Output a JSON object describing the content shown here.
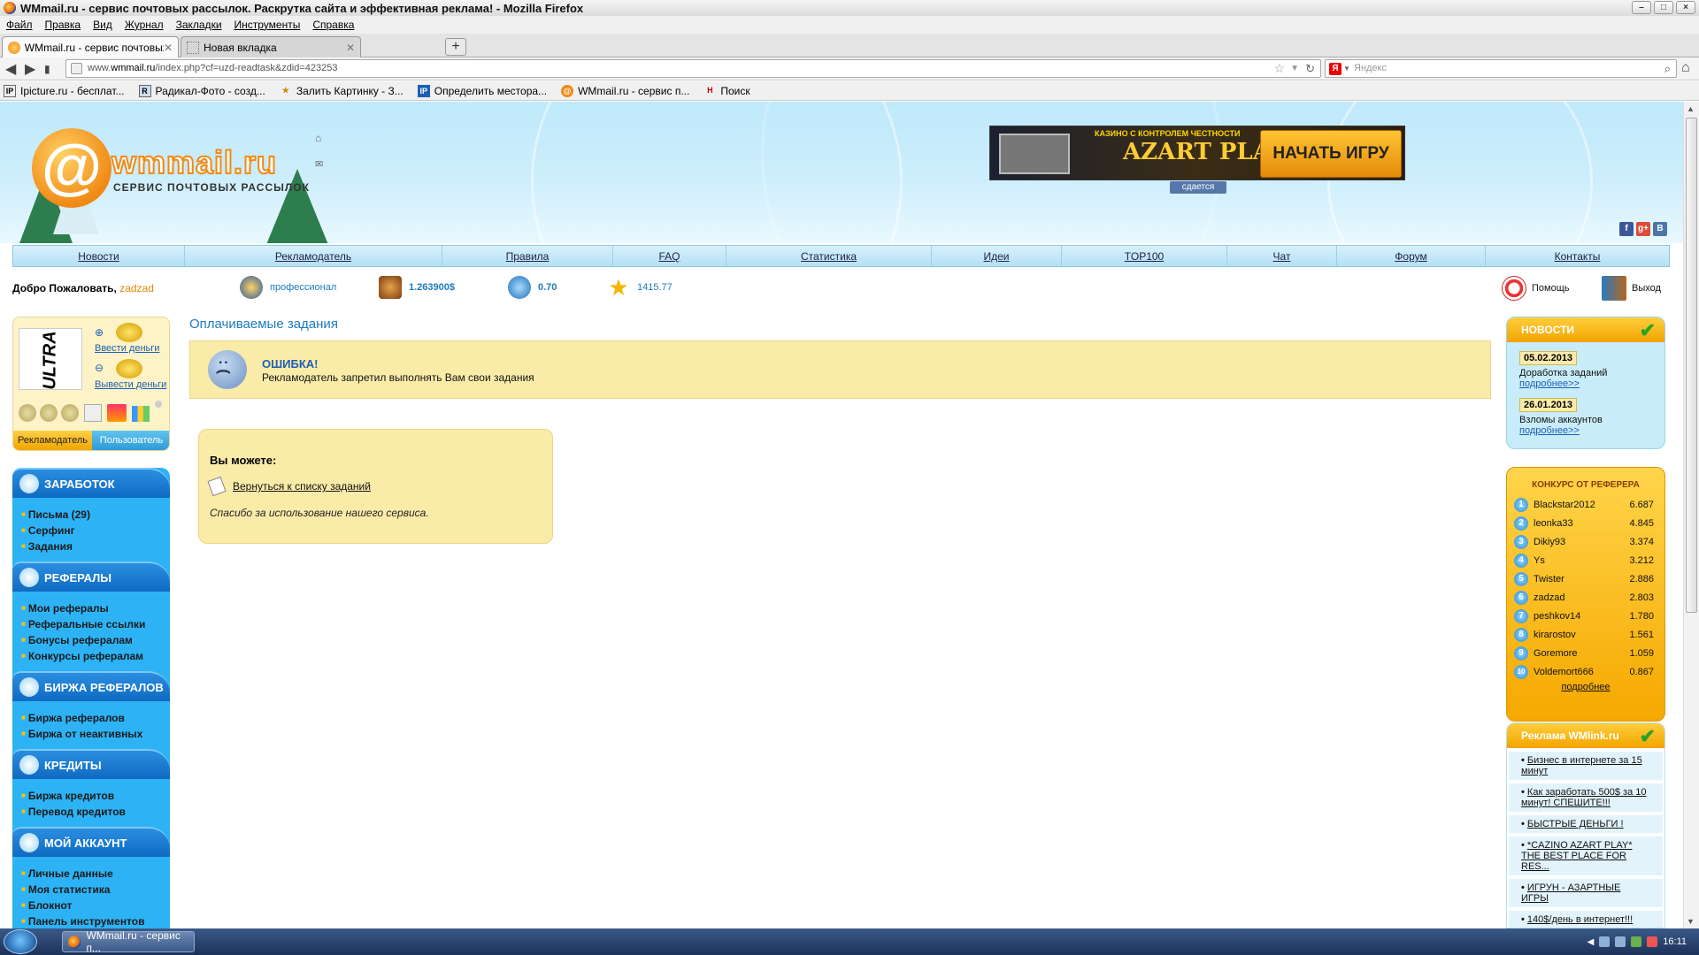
{
  "window": {
    "title": "WMmail.ru - сервис почтовых рассылок. Раскрутка сайта и эффективная реклама! - Mozilla Firefox"
  },
  "menubar": [
    "Файл",
    "Правка",
    "Вид",
    "Журнал",
    "Закладки",
    "Инструменты",
    "Справка"
  ],
  "tabs": [
    {
      "label": "WMmail.ru - сервис почтовых рассылок...",
      "active": true
    },
    {
      "label": "Новая вкладка",
      "active": false
    }
  ],
  "address": {
    "prefix": "www.",
    "domain": "wmmail.ru",
    "path": "/index.php?cf=uzd-readtask&zdid=423253"
  },
  "search": {
    "placeholder": "Яндекс",
    "engine_glyph": "Я"
  },
  "bookmarks": [
    {
      "label": "Ipicture.ru - бесплат...",
      "glyph": "IP"
    },
    {
      "label": "Радикал-Фото - созд...",
      "glyph": "R"
    },
    {
      "label": "Залить Картинку - З...",
      "glyph": "★"
    },
    {
      "label": "Определить местора...",
      "glyph": "IP"
    },
    {
      "label": "WMmail.ru - сервис п...",
      "glyph": "@"
    },
    {
      "label": "Поиск",
      "glyph": "H"
    }
  ],
  "header": {
    "logo_at": "@",
    "logo_name": "wmmail.ru",
    "logo_sub": "СЕРВИС ПОЧТОВЫХ РАССЫЛОК",
    "banner_slogan": "КАЗИНО С КОНТРОЛЕМ ЧЕСТНОСТИ",
    "banner_brand": "AZART PLAY",
    "banner_cta": "НАЧАТЬ ИГРУ",
    "banner_rent": "сдается",
    "social": [
      {
        "glyph": "f",
        "color": "#3b5998"
      },
      {
        "glyph": "g+",
        "color": "#dd4b39"
      },
      {
        "glyph": "B",
        "color": "#4a76a8"
      }
    ]
  },
  "topmenu": [
    "Новости",
    "Рекламодатель",
    "Правила",
    "FAQ",
    "Статистика",
    "Идеи",
    "TOP100",
    "Чат",
    "Форум",
    "Контакты"
  ],
  "welcome": {
    "label": "Добро Пожаловать,",
    "username": "zadzad",
    "status": "профессионал",
    "balance": "1.263900$",
    "credits": "0.70",
    "rating": "1415.77",
    "help": "Помощь",
    "logout": "Выход"
  },
  "userbox": {
    "avatar_text": "ULTRA",
    "deposit": "Ввести деньги",
    "withdraw": "Вывести деньги",
    "role_advertiser": "Рекламодатель",
    "role_user": "Пользователь"
  },
  "leftnav": [
    {
      "title": "ЗАРАБОТОК",
      "items": [
        "Письма (29)",
        "Серфинг",
        "Задания"
      ]
    },
    {
      "title": "РЕФЕРАЛЫ",
      "items": [
        "Мои рефералы",
        "Реферальные ссылки",
        "Бонусы рефералам",
        "Конкурсы рефералам"
      ]
    },
    {
      "title": "БИРЖА РЕФЕРАЛОВ",
      "items": [
        "Биржа рефералов",
        "Биржа от неактивных"
      ]
    },
    {
      "title": "КРЕДИТЫ",
      "items": [
        "Биржа кредитов",
        "Перевод кредитов"
      ]
    },
    {
      "title": "МОЙ АККАУНТ",
      "items": [
        "Личные данные",
        "Моя статистика",
        "Блокнот",
        "Панель инструментов"
      ]
    }
  ],
  "content": {
    "title": "Оплачиваемые задания",
    "error_title": "ОШИБКА!",
    "error_message": "Рекламодатель запретил выполнять Вам свои задания",
    "can_title": "Вы можете:",
    "back_link": "Вернуться к списку заданий",
    "thanks": "Спасибо за использование нашего сервиса."
  },
  "news": {
    "title": "НОВОСТИ",
    "items": [
      {
        "date": "05.02.2013",
        "text": "Доработка заданий",
        "more": "подробнее>>"
      },
      {
        "date": "26.01.2013",
        "text": "Взломы аккаунтов",
        "more": "подробнее>>"
      }
    ]
  },
  "contest": {
    "title": "КОНКУРС ОТ РЕФЕРЕРА",
    "rows": [
      {
        "rank": "1",
        "user": "Blackstar2012",
        "value": "6.687"
      },
      {
        "rank": "2",
        "user": "leonka33",
        "value": "4.845"
      },
      {
        "rank": "3",
        "user": "Dikiy93",
        "value": "3.374"
      },
      {
        "rank": "4",
        "user": "Ys",
        "value": "3.212"
      },
      {
        "rank": "5",
        "user": "Twister",
        "value": "2.886"
      },
      {
        "rank": "6",
        "user": "zadzad",
        "value": "2.803"
      },
      {
        "rank": "7",
        "user": "peshkov14",
        "value": "1.780"
      },
      {
        "rank": "8",
        "user": "kirarostov",
        "value": "1.561"
      },
      {
        "rank": "9",
        "user": "Goremore",
        "value": "1.059"
      },
      {
        "rank": "10",
        "user": "Voldemort666",
        "value": "0.867"
      }
    ],
    "more": "подробнее"
  },
  "ads": {
    "title": "Реклама WMlink.ru",
    "items": [
      "Бизнес в интернете за 15 минут",
      "Как заработать 500$ за 10 минут! СПЕШИТЕ!!!",
      "БЫСТРЫЕ ДЕНЬГИ !",
      "*CAZINO AZART PLAY* THE BEST PLACE FOR RES...",
      "ИГРУН - АЗАРТНЫЕ ИГРЫ",
      "140$/день в интернет!!!"
    ]
  },
  "taskbar": {
    "item": "WMmail.ru - сервис п...",
    "clock": "16:11"
  },
  "colors": {
    "accent_blue": "#1d7abf",
    "nav_blue": "#2db3f5",
    "warning_yellow": "#fbeba9",
    "orange": "#f2a400"
  }
}
